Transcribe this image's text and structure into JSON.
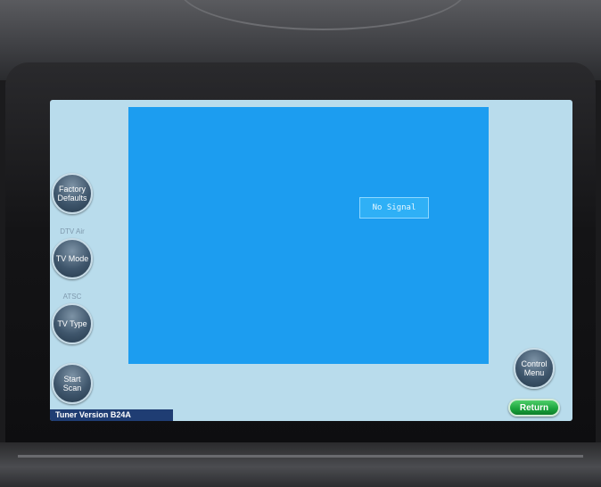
{
  "tv_screen": {
    "status": "No Signal"
  },
  "side_buttons": {
    "factory_defaults": [
      "Factory",
      "Defaults"
    ],
    "tv_mode": {
      "caption": "DTV Air",
      "label": "TV Mode"
    },
    "tv_type": {
      "caption": "ATSC",
      "label": "TV Type"
    },
    "start_scan": [
      "Start",
      "Scan"
    ]
  },
  "right_buttons": {
    "control_menu": [
      "Control",
      "Menu"
    ],
    "return_label": "Return"
  },
  "footer": {
    "version": "Tuner Version B24A"
  },
  "colors": {
    "screen_bg": "#b9dcec",
    "video_bg": "#1c9df0",
    "version_bar": "#1f3d73",
    "return_button": "#19a23b"
  }
}
